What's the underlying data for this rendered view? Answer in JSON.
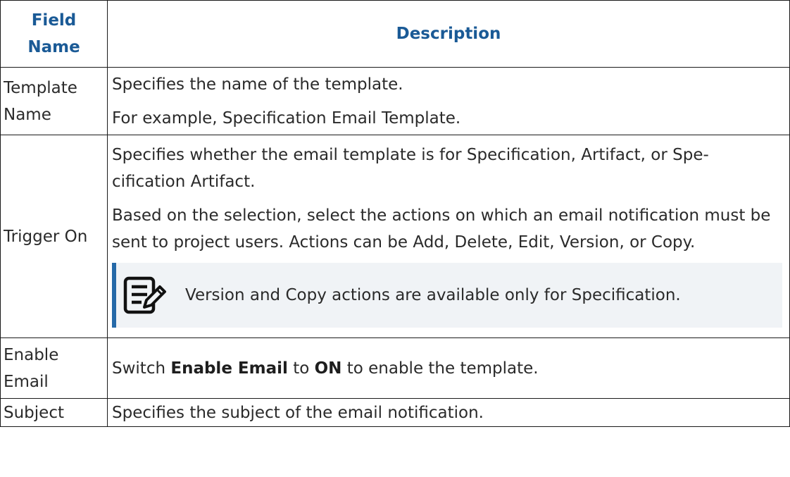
{
  "header": {
    "field_name": "Field Name",
    "description": "Description"
  },
  "rows": {
    "template_name": {
      "field": "Template Name",
      "desc1": "Specifies the name of the template.",
      "desc2": "For example, Specification Email Template."
    },
    "trigger_on": {
      "field": "Trigger On",
      "desc1": "Specifies whether the email template is for Specification, Artifact, or Spe-cification Artifact.",
      "desc2": "Based on the selection, select the actions on which an email notification must be sent to project users. Actions can be Add, Delete, Edit, Version, or Copy.",
      "note": "Version and Copy actions are available only for Specification.",
      "note_icon": "note-edit-icon"
    },
    "enable_email": {
      "field": "Enable Email",
      "pre": "Switch ",
      "bold1": "Enable Email",
      "mid": " to ",
      "bold2": "ON",
      "post": " to enable the template."
    },
    "subject": {
      "field": "Subject",
      "desc1": "Specifies the subject of the email notification."
    }
  },
  "colors": {
    "header_text": "#1a5a96",
    "note_bg": "#f0f3f6",
    "note_bar": "#2569a8"
  }
}
